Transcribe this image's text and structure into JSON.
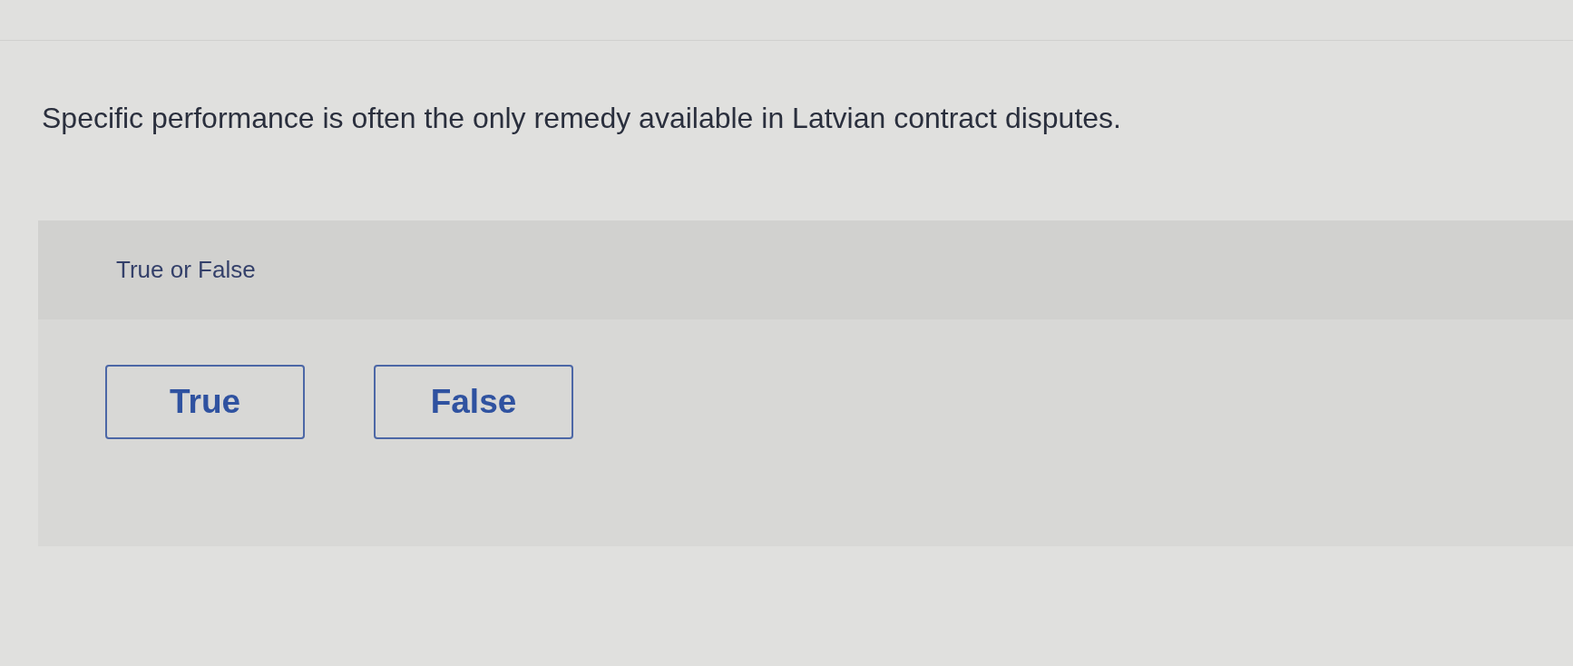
{
  "question": {
    "text": "Specific performance is often the only remedy available in Latvian contract disputes."
  },
  "answer_panel": {
    "prompt": "True or False",
    "options": [
      {
        "label": "True",
        "selected": false
      },
      {
        "label": "False",
        "selected": false
      }
    ]
  }
}
